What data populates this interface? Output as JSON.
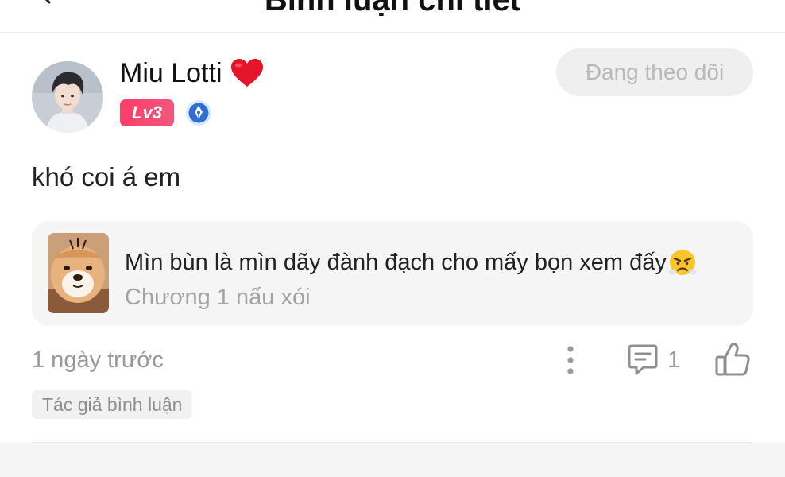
{
  "header": {
    "title": "Bình luận chi tiết",
    "back_icon": "back-arrow-icon"
  },
  "comment": {
    "user": {
      "name": "Miu Lotti",
      "name_icon": "heart-icon",
      "level": "Lv3",
      "medal_icon": "pen-medal-icon"
    },
    "follow_label": "Đang theo dõi",
    "text": "khó coi á em",
    "reference": {
      "title": "Mìn bùn là mìn dãy đành đạch cho mấy bọn xem đấy",
      "emoji_icon": "angry-face-icon",
      "subtitle": "Chương 1 nấu xói"
    },
    "timestamp": "1 ngày trước",
    "reply_count": "1",
    "author_tag": "Tác giả bình luận"
  },
  "colors": {
    "level_badge": "#ff3d67",
    "follow_bg": "#efefef",
    "follow_text": "#b9b9b9",
    "card_bg": "#f5f5f5",
    "muted_text": "#999999"
  }
}
